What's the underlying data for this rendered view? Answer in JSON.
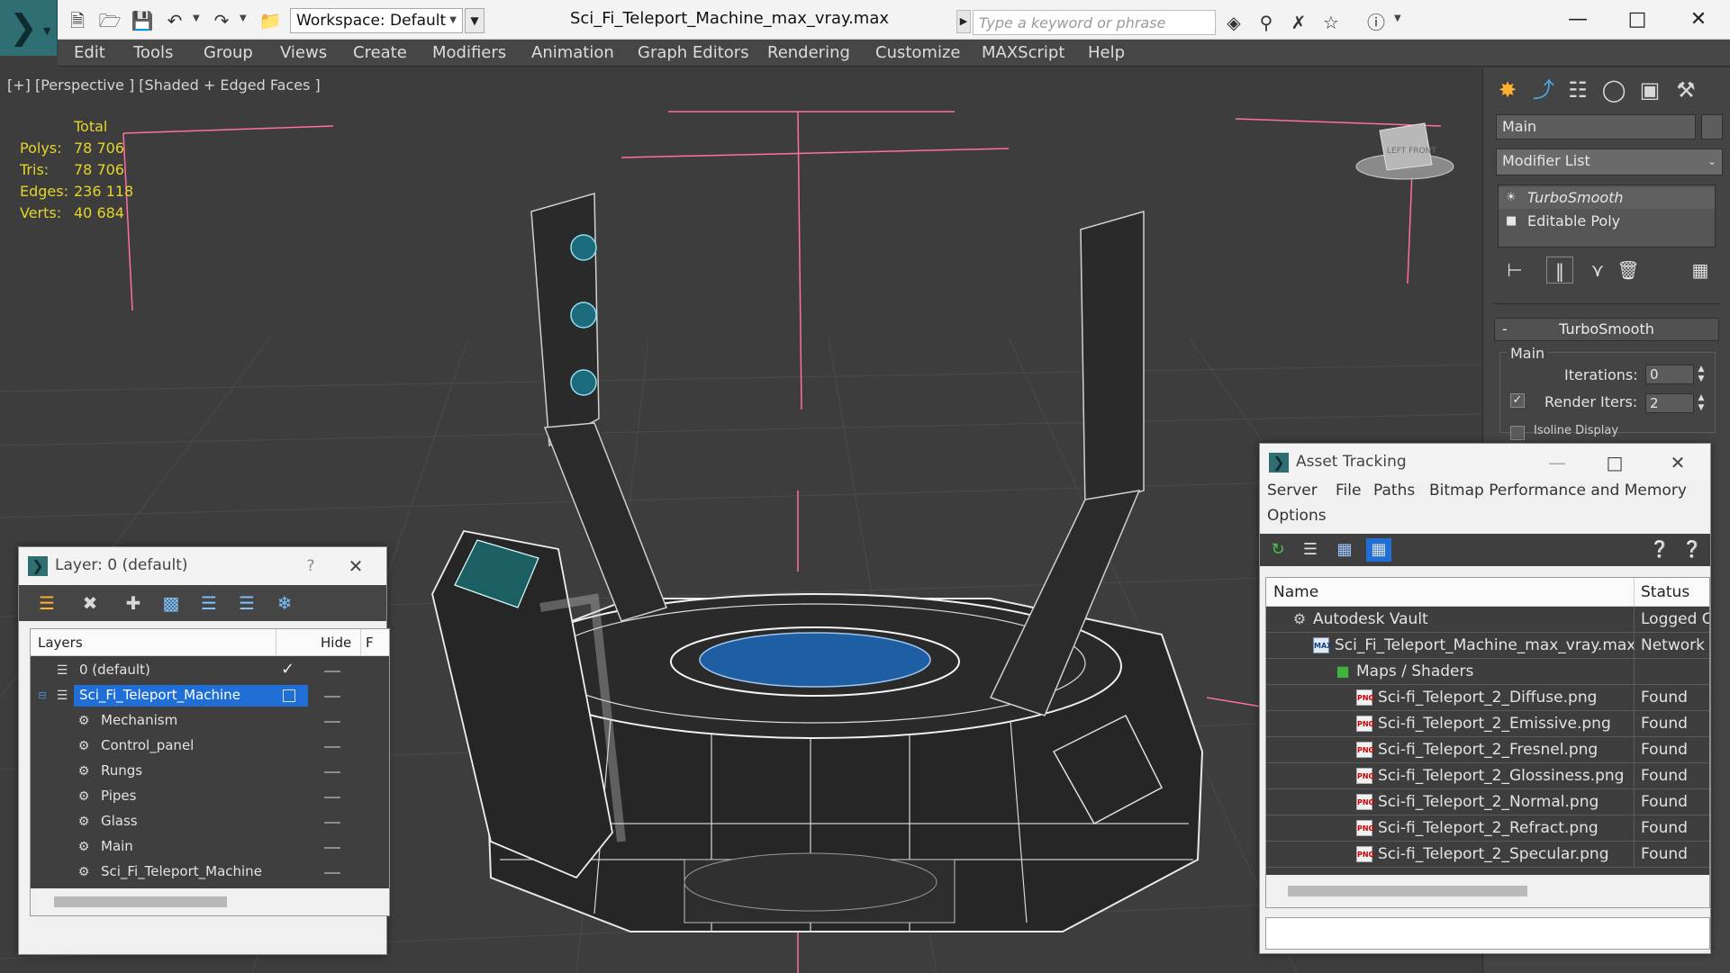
{
  "titlebar": {
    "workspace_label": "Workspace: Default",
    "document_title": "Sci_Fi_Teleport_Machine_max_vray.max",
    "search_placeholder": "Type a keyword or phrase"
  },
  "menu": [
    "Edit",
    "Tools",
    "Group",
    "Views",
    "Create",
    "Modifiers",
    "Animation",
    "Graph Editors",
    "Rendering",
    "Customize",
    "MAXScript",
    "Help"
  ],
  "viewport": {
    "label": "[+] [Perspective ] [Shaded + Edged Faces ]",
    "stats": {
      "header": "Total",
      "rows": [
        {
          "label": "Polys:",
          "value": "78 706"
        },
        {
          "label": "Tris:",
          "value": "78 706"
        },
        {
          "label": "Edges:",
          "value": "236 118"
        },
        {
          "label": "Verts:",
          "value": "40 684"
        }
      ]
    },
    "viewcube_label": "LEFT  FRONT"
  },
  "command_panel": {
    "object_name": "Main",
    "modifier_list": "Modifier List",
    "stack": [
      "TurboSmooth",
      "Editable Poly"
    ],
    "rollout_title": "TurboSmooth",
    "group_label": "Main",
    "iterations_label": "Iterations:",
    "iterations_value": "0",
    "render_iters_label": "Render Iters:",
    "render_iters_value": "2",
    "isoline_label": "Isoline Display"
  },
  "layer_window": {
    "title": "Layer: 0 (default)",
    "help": "?",
    "columns": {
      "layers": "Layers",
      "hide": "Hide",
      "freeze": "F"
    },
    "rows": [
      {
        "name": "0 (default)",
        "level": 1,
        "type": "layer",
        "current": true
      },
      {
        "name": "Sci_Fi_Teleport_Machine",
        "level": 1,
        "type": "layer",
        "selected": true
      },
      {
        "name": "Mechanism",
        "level": 2,
        "type": "object"
      },
      {
        "name": "Control_panel",
        "level": 2,
        "type": "object"
      },
      {
        "name": "Rungs",
        "level": 2,
        "type": "object"
      },
      {
        "name": "Pipes",
        "level": 2,
        "type": "object"
      },
      {
        "name": "Glass",
        "level": 2,
        "type": "object"
      },
      {
        "name": "Main",
        "level": 2,
        "type": "object"
      },
      {
        "name": "Sci_Fi_Teleport_Machine",
        "level": 2,
        "type": "object"
      }
    ]
  },
  "asset_window": {
    "title": "Asset Tracking",
    "menu": [
      "Server",
      "File",
      "Paths",
      "Bitmap Performance and Memory",
      "Options"
    ],
    "columns": {
      "name": "Name",
      "status": "Status"
    },
    "rows": [
      {
        "name": "Autodesk Vault",
        "status": "Logged C",
        "level": 1,
        "icon": "vault"
      },
      {
        "name": "Sci_Fi_Teleport_Machine_max_vray.max",
        "status": "Network",
        "level": 2,
        "icon": "max"
      },
      {
        "name": "Maps / Shaders",
        "status": "",
        "level": 3,
        "icon": "maps"
      },
      {
        "name": "Sci-fi_Teleport_2_Diffuse.png",
        "status": "Found",
        "level": 4,
        "icon": "png"
      },
      {
        "name": "Sci-fi_Teleport_2_Emissive.png",
        "status": "Found",
        "level": 4,
        "icon": "png"
      },
      {
        "name": "Sci-fi_Teleport_2_Fresnel.png",
        "status": "Found",
        "level": 4,
        "icon": "png"
      },
      {
        "name": "Sci-fi_Teleport_2_Glossiness.png",
        "status": "Found",
        "level": 4,
        "icon": "png"
      },
      {
        "name": "Sci-fi_Teleport_2_Normal.png",
        "status": "Found",
        "level": 4,
        "icon": "png"
      },
      {
        "name": "Sci-fi_Teleport_2_Refract.png",
        "status": "Found",
        "level": 4,
        "icon": "png"
      },
      {
        "name": "Sci-fi_Teleport_2_Specular.png",
        "status": "Found",
        "level": 4,
        "icon": "png"
      }
    ]
  },
  "colors": {
    "stats_yellow": "#e5d42a",
    "selection_blue": "#1f6fd6",
    "app_teal": "#2f6f73",
    "wire_pink": "#ff6fa0"
  }
}
